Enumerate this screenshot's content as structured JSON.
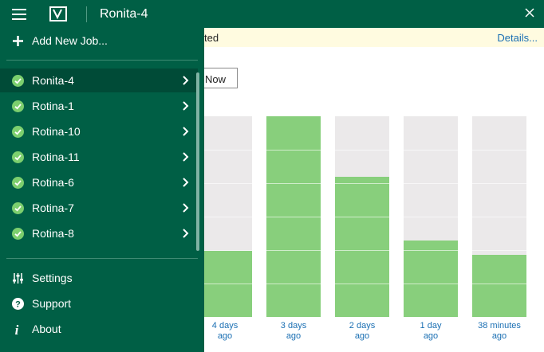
{
  "titlebar": {
    "title": "Ronita-4"
  },
  "banner": {
    "message": "ted",
    "details_link": "Details..."
  },
  "action_button": {
    "label": "Now"
  },
  "sidebar": {
    "add_job": "Add New Job...",
    "jobs": [
      {
        "label": "Ronita-4",
        "active": true
      },
      {
        "label": "Rotina-1"
      },
      {
        "label": "Rotina-10"
      },
      {
        "label": "Rotina-11"
      },
      {
        "label": "Rotina-6"
      },
      {
        "label": "Rotina-7"
      },
      {
        "label": "Rotina-8"
      }
    ],
    "footer": [
      {
        "label": "Settings",
        "icon": "settings-sliders-icon"
      },
      {
        "label": "Support",
        "icon": "question-icon"
      },
      {
        "label": "About",
        "icon": "info-icon"
      }
    ]
  },
  "chart_data": {
    "type": "bar",
    "categories": [
      "4 days ago",
      "3 days ago",
      "2 days ago",
      "1 day ago",
      "38 minutes ago"
    ],
    "category_lines": [
      [
        "4 days",
        "ago"
      ],
      [
        "3 days",
        "ago"
      ],
      [
        "2 days",
        "ago"
      ],
      [
        "1 day",
        "ago"
      ],
      [
        "38 minutes",
        "ago"
      ]
    ],
    "values": [
      33,
      100,
      70,
      38,
      31
    ],
    "ylim": [
      0,
      100
    ]
  },
  "colors": {
    "accent": "#005f45",
    "bar": "#88cf7c",
    "bar_bg": "#ebe9ea",
    "link": "#1a6fb3"
  }
}
